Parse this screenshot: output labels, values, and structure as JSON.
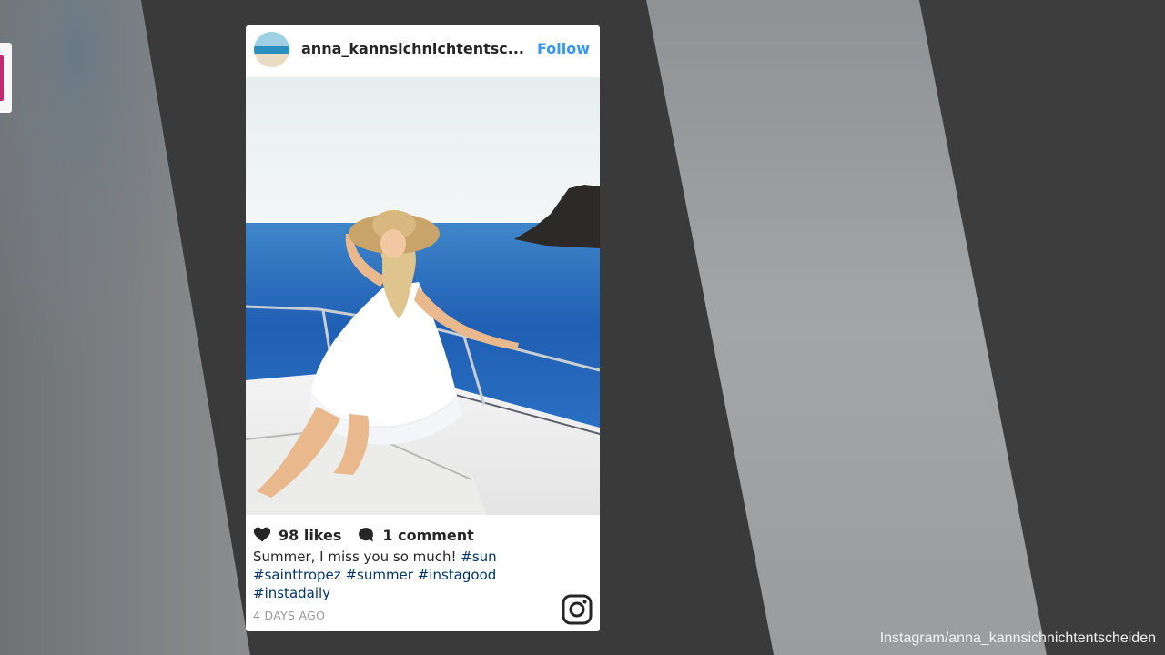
{
  "post": {
    "username": "anna_kannsichnichtentsc...",
    "follow_label": "Follow",
    "likes": "98 likes",
    "comments": "1 comment",
    "caption_text": "Summer, I miss you so much! ",
    "hashtags": [
      "#sun",
      "#sainttropez",
      "#summer",
      "#instagood",
      "#instadaily"
    ],
    "timestamp": "4 DAYS AGO"
  },
  "credit": "Instagram/anna_kannsichnichtentscheiden",
  "icons": {
    "like": "heart-icon",
    "comment": "comment-bubble-icon",
    "brand": "instagram-logo-icon"
  },
  "colors": {
    "follow": "#3897f0",
    "hashtag": "#003569",
    "text": "#262626",
    "timestamp": "#999999"
  }
}
